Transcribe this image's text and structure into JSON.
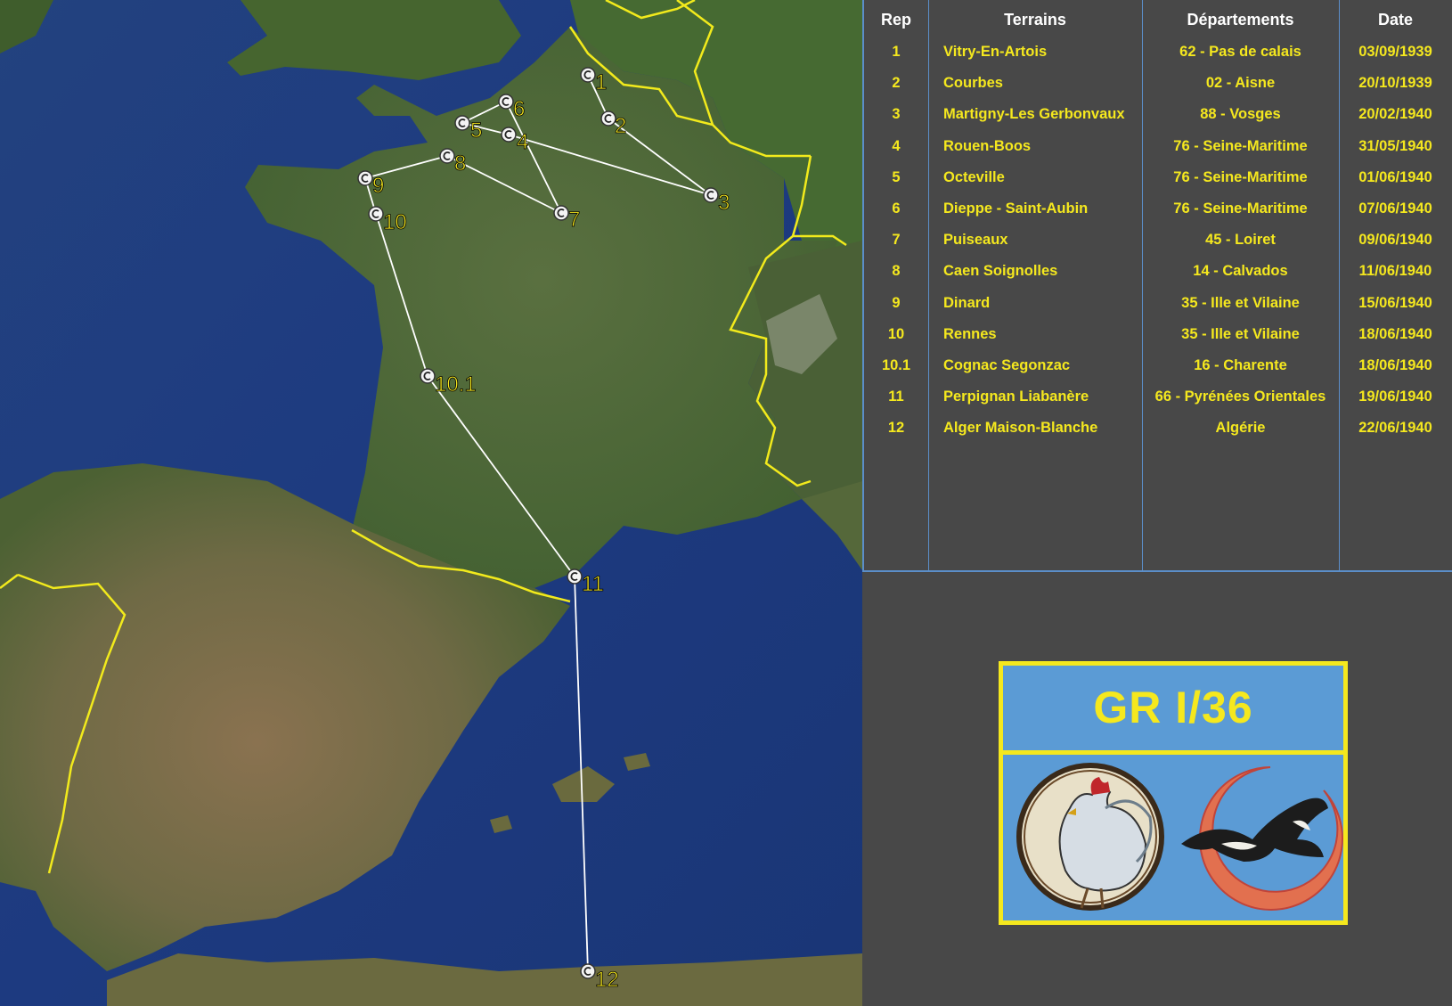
{
  "table": {
    "headers": {
      "rep": "Rep",
      "terrain": "Terrains",
      "dept": "Départements",
      "date": "Date"
    },
    "rows": [
      {
        "rep": "1",
        "terrain": "Vitry-En-Artois",
        "dept": "62 - Pas de calais",
        "date": "03/09/1939"
      },
      {
        "rep": "2",
        "terrain": "Courbes",
        "dept": "02 - Aisne",
        "date": "20/10/1939"
      },
      {
        "rep": "3",
        "terrain": "Martigny-Les Gerbonvaux",
        "dept": "88 - Vosges",
        "date": "20/02/1940"
      },
      {
        "rep": "4",
        "terrain": "Rouen-Boos",
        "dept": "76 - Seine-Maritime",
        "date": "31/05/1940"
      },
      {
        "rep": "5",
        "terrain": "Octeville",
        "dept": "76 - Seine-Maritime",
        "date": "01/06/1940"
      },
      {
        "rep": "6",
        "terrain": "Dieppe - Saint-Aubin",
        "dept": "76 - Seine-Maritime",
        "date": "07/06/1940"
      },
      {
        "rep": "7",
        "terrain": "Puiseaux",
        "dept": "45 - Loiret",
        "date": "09/06/1940"
      },
      {
        "rep": "8",
        "terrain": "Caen Soignolles",
        "dept": "14 - Calvados",
        "date": "11/06/1940"
      },
      {
        "rep": "9",
        "terrain": "Dinard",
        "dept": "35 - Ille et Vilaine",
        "date": "15/06/1940"
      },
      {
        "rep": "10",
        "terrain": "Rennes",
        "dept": "35 - Ille et Vilaine",
        "date": "18/06/1940"
      },
      {
        "rep": "10.1",
        "terrain": "Cognac Segonzac",
        "dept": "16 - Charente",
        "date": "18/06/1940"
      },
      {
        "rep": "11",
        "terrain": "Perpignan Liabanère",
        "dept": "66 - Pyrénées Orientales",
        "date": "19/06/1940"
      },
      {
        "rep": "12",
        "terrain": "Alger Maison-Blanche",
        "dept": "Algérie",
        "date": "22/06/1940"
      }
    ]
  },
  "emblem": {
    "title": "GR I/36"
  },
  "map": {
    "markers": [
      "1",
      "2",
      "3",
      "4",
      "5",
      "6",
      "7",
      "8",
      "9",
      "10",
      "10.1",
      "11",
      "12"
    ],
    "colors": {
      "sea": "#1f3e86",
      "land": "#4d6a36",
      "border": "#f2ea1c",
      "route": "#ffffff",
      "label": "#f5e81e"
    }
  }
}
